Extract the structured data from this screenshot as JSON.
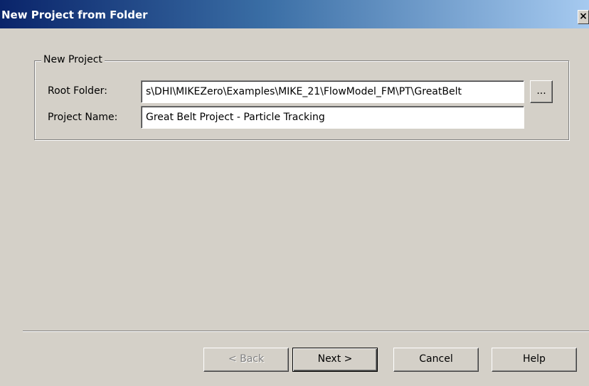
{
  "window": {
    "title": "New Project from Folder",
    "close_label": "×"
  },
  "group": {
    "legend": "New Project",
    "root_folder_label": "Root Folder:",
    "root_folder_value": "s\\DHI\\MIKEZero\\Examples\\MIKE_21\\FlowModel_FM\\PT\\GreatBelt",
    "browse_label": "...",
    "project_name_label": "Project Name:",
    "project_name_value": "Great Belt Project - Particle Tracking"
  },
  "buttons": {
    "back": "< Back",
    "next": "Next >",
    "cancel": "Cancel",
    "help": "Help"
  },
  "colors": {
    "dialog_bg": "#d4d0c8",
    "titlebar_start": "#0a246a",
    "titlebar_end": "#a6caf0"
  }
}
